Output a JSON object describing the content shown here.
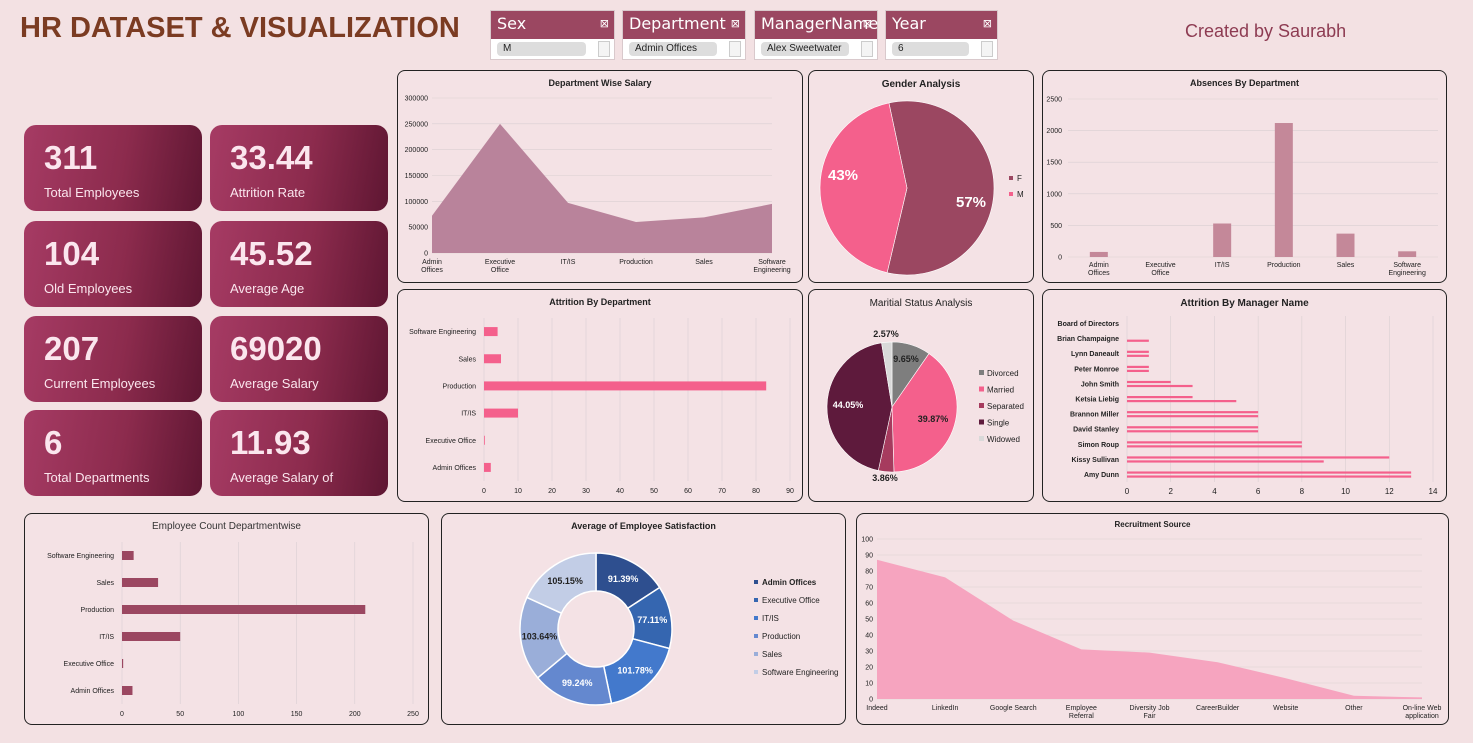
{
  "header": {
    "title": "HR DATASET & VISUALIZATION",
    "creator": "Created by Saurabh",
    "filter_icon": "filter-clear-icon"
  },
  "slicers": [
    {
      "label": "Sex",
      "value": "M"
    },
    {
      "label": "Department",
      "value": "Admin Offices"
    },
    {
      "label": "ManagerName",
      "value": "Alex Sweetwater"
    },
    {
      "label": "Year",
      "value": "6"
    }
  ],
  "kpis": [
    {
      "value": "311",
      "label": "Total Employees"
    },
    {
      "value": "33.44",
      "label": "Attrition Rate"
    },
    {
      "value": "104",
      "label": "Old Employees"
    },
    {
      "value": "45.52",
      "label": "Average Age"
    },
    {
      "value": "207",
      "label": "Current Employees"
    },
    {
      "value": "69020",
      "label": "Average Salary"
    },
    {
      "value": "6",
      "label": "Total Departments"
    },
    {
      "value": "11.93",
      "label": "Average Salary of"
    }
  ],
  "colors": {
    "maroon": "#9b4761",
    "pink": "#f4608c",
    "area_maroon": "#b9839b",
    "area_pink": "#f6a4bf",
    "bg": "#f3e1e3"
  },
  "chart_data": [
    {
      "id": "dept_salary",
      "type": "area",
      "title": "Department Wise Salary",
      "categories": [
        "Admin Offices",
        "Executive Office",
        "IT/IS",
        "Production",
        "Sales",
        "Software Engineering"
      ],
      "values": [
        72000,
        250000,
        97000,
        60000,
        69000,
        95000
      ],
      "yticks": [
        "0",
        "50000",
        "100000",
        "150000",
        "200000",
        "250000",
        "300000"
      ],
      "ylim": [
        0,
        300000
      ]
    },
    {
      "id": "gender",
      "type": "pie",
      "title": "Gender Analysis",
      "labels": [
        "F",
        "M"
      ],
      "values": [
        57,
        43
      ],
      "data_labels": [
        "57%",
        "43%"
      ],
      "colors": [
        "#9b4761",
        "#f4608c"
      ]
    },
    {
      "id": "absences",
      "type": "bar",
      "title": "Absences By Department",
      "categories": [
        "Admin Offices",
        "Executive Office",
        "IT/IS",
        "Production",
        "Sales",
        "Software Engineering"
      ],
      "values": [
        80,
        0,
        530,
        2120,
        370,
        90
      ],
      "yticks": [
        "0",
        "500",
        "1000",
        "1500",
        "2000",
        "2500"
      ],
      "ylim": [
        0,
        2500
      ]
    },
    {
      "id": "attrition_dept",
      "type": "bar",
      "title": "Attrition By Department",
      "categories": [
        "Software Engineering",
        "Sales",
        "Production",
        "IT/IS",
        "Executive Office",
        "Admin Offices"
      ],
      "values": [
        4,
        5,
        83,
        10,
        0,
        2
      ],
      "xticks": [
        "0",
        "10",
        "20",
        "30",
        "40",
        "50",
        "60",
        "70",
        "80",
        "90"
      ],
      "xlim": [
        0,
        90
      ]
    },
    {
      "id": "marital",
      "type": "pie",
      "title": "Maritial Status Analysis",
      "labels": [
        "Divorced",
        "Married",
        "Separated",
        "Single",
        "Widowed"
      ],
      "values": [
        9.65,
        39.87,
        3.86,
        44.05,
        2.57
      ],
      "data_labels": [
        "9.65%",
        "39.87%",
        "3.86%",
        "44.05%",
        "2.57%"
      ],
      "colors": [
        "#7e7e7e",
        "#f4608c",
        "#a63b5e",
        "#5e1a3c",
        "#d9d9d9"
      ]
    },
    {
      "id": "attrition_manager",
      "type": "bar",
      "title": "Attrition By Manager Name",
      "categories": [
        "Board of Directors",
        "Brian Champaigne",
        "Lynn Daneault",
        "Peter Monroe",
        "John Smith",
        "Ketsia Liebig",
        "Brannon Miller",
        "David Stanley",
        "Simon Roup",
        "Kissy Sullivan",
        "Amy Dunn"
      ],
      "series": [
        {
          "values": [
            0,
            0,
            1,
            1,
            2,
            3,
            6,
            6,
            8,
            12,
            13
          ]
        },
        {
          "values": [
            0,
            1,
            1,
            1,
            3,
            5,
            6,
            6,
            8,
            9,
            13
          ]
        }
      ],
      "xticks": [
        "0",
        "2",
        "4",
        "6",
        "8",
        "10",
        "12",
        "14"
      ],
      "xlim": [
        0,
        14
      ]
    },
    {
      "id": "emp_count",
      "type": "bar",
      "title": "Employee Count Departmentwise",
      "categories": [
        "Software Engineering",
        "Sales",
        "Production",
        "IT/IS",
        "Executive Office",
        "Admin Offices"
      ],
      "values": [
        10,
        31,
        209,
        50,
        1,
        9
      ],
      "xticks": [
        "0",
        "50",
        "100",
        "150",
        "200",
        "250"
      ],
      "xlim": [
        0,
        250
      ]
    },
    {
      "id": "satisfaction",
      "type": "pie",
      "title": "Average of Employee Satisfaction",
      "labels": [
        "Admin Offices",
        "Executive Office",
        "IT/IS",
        "Production",
        "Sales",
        "Software Engineering"
      ],
      "values": [
        91.39,
        77.11,
        101.78,
        99.24,
        103.64,
        105.15
      ],
      "data_labels": [
        "91.39%",
        "77.11%",
        "101.78%",
        "99.24%",
        "103.64%",
        "105.15%"
      ],
      "colors": [
        "#2e4f8f",
        "#3566b0",
        "#4379cc",
        "#6488cf",
        "#9aaed9",
        "#c2cde6"
      ]
    },
    {
      "id": "recruitment",
      "type": "area",
      "title": "Recruitment Source",
      "categories": [
        "Indeed",
        "LinkedIn",
        "Google Search",
        "Employee Referral",
        "Diversity Job Fair",
        "CareerBuilder",
        "Website",
        "Other",
        "On-line Web application"
      ],
      "values": [
        87,
        76,
        49,
        31,
        29,
        23,
        13,
        2,
        1
      ],
      "yticks": [
        "0",
        "10",
        "20",
        "30",
        "40",
        "50",
        "60",
        "70",
        "80",
        "90",
        "100"
      ],
      "ylim": [
        0,
        100
      ]
    }
  ]
}
